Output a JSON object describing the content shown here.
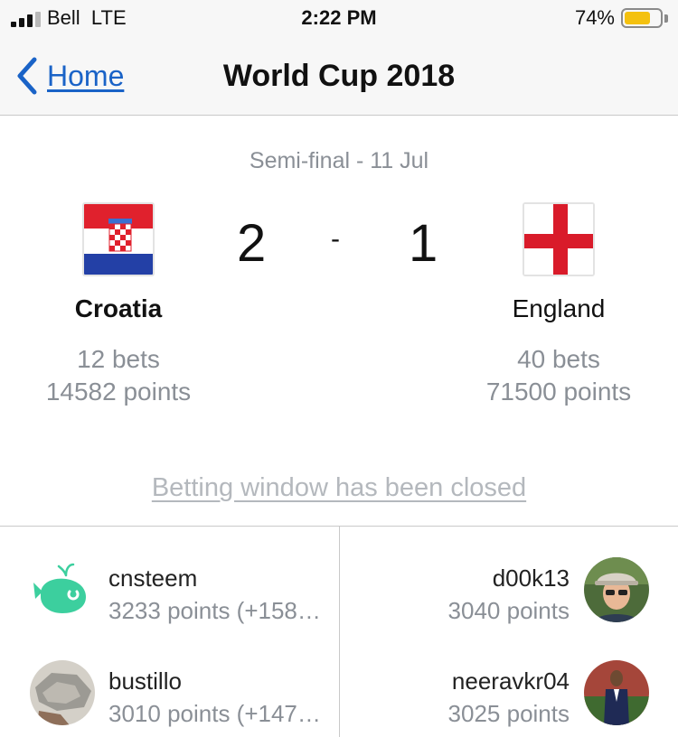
{
  "status_bar": {
    "carrier": "Bell",
    "network": "LTE",
    "time": "2:22 PM",
    "battery_percent": "74%",
    "battery_level": 0.74,
    "signal_bars_filled": 3,
    "signal_bars_total": 5
  },
  "nav": {
    "back_label": "Home",
    "back_icon": "chevron-left-icon",
    "title": "World Cup 2018"
  },
  "match": {
    "round_date": "Semi-final - 11 Jul",
    "home": {
      "name": "Croatia",
      "flag_icon": "croatia-flag-icon",
      "score": "2",
      "bets": "12 bets",
      "points": "14582 points"
    },
    "separator": "-",
    "away": {
      "name": "England",
      "flag_icon": "england-flag-icon",
      "score": "1",
      "bets": "40 bets",
      "points": "71500 points"
    },
    "status_link": "Betting window has been closed"
  },
  "leaderboard": {
    "home_bettors": [
      {
        "name": "cnsteem",
        "points": "3233 points (+158…",
        "avatar_icon": "whale-avatar-icon"
      },
      {
        "name": "bustillo",
        "points": "3010 points (+147…",
        "avatar_icon": "rock-avatar-icon"
      }
    ],
    "away_bettors": [
      {
        "name": "d00k13",
        "points": "3040 points",
        "avatar_icon": "person-cap-avatar-icon"
      },
      {
        "name": "neeravkr04",
        "points": "3025 points",
        "avatar_icon": "person-suit-avatar-icon"
      }
    ]
  },
  "colors": {
    "link_blue": "#1a63c7",
    "muted_gray": "#8a8f96",
    "battery_yellow": "#f4c10f",
    "england_red": "#d91b2a",
    "croatia_red": "#e0212d",
    "croatia_blue": "#2340a6",
    "whale_teal": "#3ccf9e"
  }
}
